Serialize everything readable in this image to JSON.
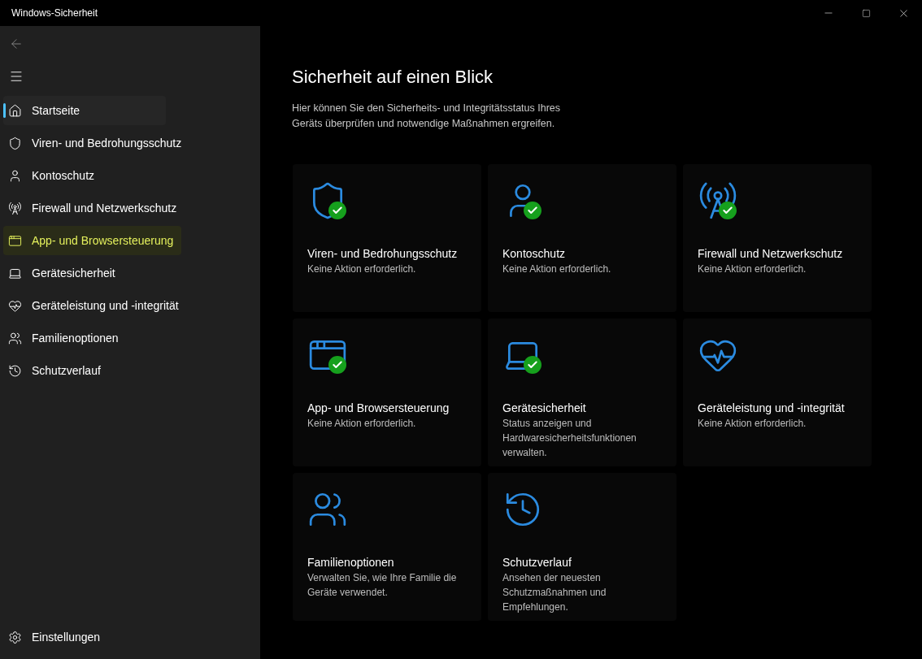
{
  "window": {
    "title": "Windows-Sicherheit"
  },
  "nav": [
    {
      "label": "Startseite",
      "selected": true,
      "highlighted": false
    },
    {
      "label": "Viren- und Bedrohungsschutz",
      "selected": false,
      "highlighted": false
    },
    {
      "label": "Kontoschutz",
      "selected": false,
      "highlighted": false
    },
    {
      "label": "Firewall und Netzwerkschutz",
      "selected": false,
      "highlighted": false
    },
    {
      "label": "App- und Browsersteuerung",
      "selected": false,
      "highlighted": true
    },
    {
      "label": "Gerätesicherheit",
      "selected": false,
      "highlighted": false
    },
    {
      "label": "Geräteleistung und -integrität",
      "selected": false,
      "highlighted": false
    },
    {
      "label": "Familienoptionen",
      "selected": false,
      "highlighted": false
    },
    {
      "label": "Schutzverlauf",
      "selected": false,
      "highlighted": false
    }
  ],
  "settings": {
    "label": "Einstellungen"
  },
  "heading": "Sicherheit auf einen Blick",
  "intro": "Hier können Sie den Sicherheits- und Integritätsstatus Ihres Geräts überprüfen und notwendige Maßnahmen ergreifen.",
  "cards": [
    {
      "title": "Viren- und Bedrohungsschutz",
      "description": "Keine Aktion erforderlich.",
      "ok": true
    },
    {
      "title": "Kontoschutz",
      "description": "Keine Aktion erforderlich.",
      "ok": true
    },
    {
      "title": "Firewall und Netzwerkschutz",
      "description": "Keine Aktion erforderlich.",
      "ok": true
    },
    {
      "title": "App- und Browsersteuerung",
      "description": "Keine Aktion erforderlich.",
      "ok": true
    },
    {
      "title": "Gerätesicherheit",
      "description": "Status anzeigen und Hardwaresicherheitsfunktionen verwalten.",
      "ok": true
    },
    {
      "title": "Geräteleistung und -integrität",
      "description": "Keine Aktion erforderlich.",
      "ok": false
    },
    {
      "title": "Familienoptionen",
      "description": "Verwalten Sie, wie Ihre Familie die Geräte verwendet.",
      "ok": false
    },
    {
      "title": "Schutzverlauf",
      "description": "Ansehen der neuesten Schutzmaßnahmen und Empfehlungen.",
      "ok": false
    }
  ]
}
